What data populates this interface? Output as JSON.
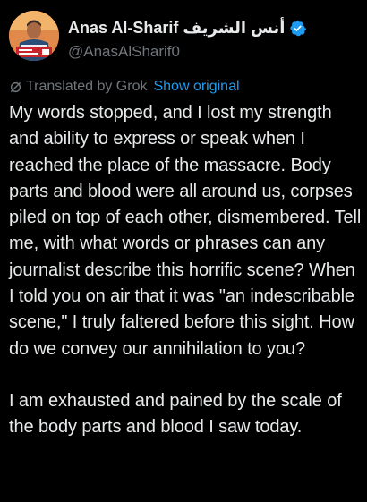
{
  "author": {
    "display_name": "Anas Al-Sharif أنس الشريف",
    "handle": "@AnasAlSharif0",
    "verified": true
  },
  "translation": {
    "label": "Translated by Grok",
    "show_original_label": "Show original"
  },
  "tweet": {
    "paragraphs": [
      "My words stopped, and I lost my strength and ability to express or speak when I reached the place of the massacre. Body parts and blood were all around us, corpses piled on top of each other, dismembered. Tell me, with what words or phrases can any journalist describe this horrific scene? When I told you on air that it was \"an indescribable scene,\" I truly faltered before this sight. How do we convey our annihilation to you?",
      "I am exhausted and pained by the scale of the body parts and blood I saw today."
    ]
  },
  "colors": {
    "background": "#000000",
    "text_primary": "#e7e9ea",
    "text_secondary": "#71767b",
    "accent": "#1d9bf0"
  }
}
